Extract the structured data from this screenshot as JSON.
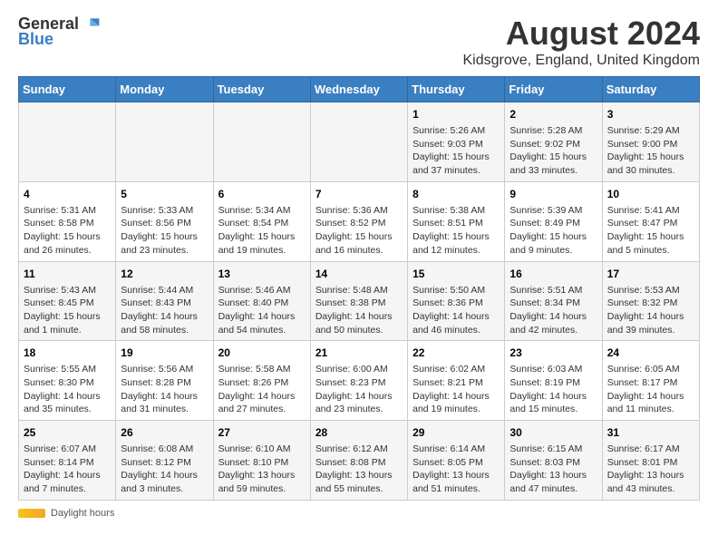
{
  "logo": {
    "general": "General",
    "blue": "Blue"
  },
  "title": "August 2024",
  "location": "Kidsgrove, England, United Kingdom",
  "days_of_week": [
    "Sunday",
    "Monday",
    "Tuesday",
    "Wednesday",
    "Thursday",
    "Friday",
    "Saturday"
  ],
  "weeks": [
    [
      {
        "day": "",
        "info": ""
      },
      {
        "day": "",
        "info": ""
      },
      {
        "day": "",
        "info": ""
      },
      {
        "day": "",
        "info": ""
      },
      {
        "day": "1",
        "info": "Sunrise: 5:26 AM\nSunset: 9:03 PM\nDaylight: 15 hours and 37 minutes."
      },
      {
        "day": "2",
        "info": "Sunrise: 5:28 AM\nSunset: 9:02 PM\nDaylight: 15 hours and 33 minutes."
      },
      {
        "day": "3",
        "info": "Sunrise: 5:29 AM\nSunset: 9:00 PM\nDaylight: 15 hours and 30 minutes."
      }
    ],
    [
      {
        "day": "4",
        "info": "Sunrise: 5:31 AM\nSunset: 8:58 PM\nDaylight: 15 hours and 26 minutes."
      },
      {
        "day": "5",
        "info": "Sunrise: 5:33 AM\nSunset: 8:56 PM\nDaylight: 15 hours and 23 minutes."
      },
      {
        "day": "6",
        "info": "Sunrise: 5:34 AM\nSunset: 8:54 PM\nDaylight: 15 hours and 19 minutes."
      },
      {
        "day": "7",
        "info": "Sunrise: 5:36 AM\nSunset: 8:52 PM\nDaylight: 15 hours and 16 minutes."
      },
      {
        "day": "8",
        "info": "Sunrise: 5:38 AM\nSunset: 8:51 PM\nDaylight: 15 hours and 12 minutes."
      },
      {
        "day": "9",
        "info": "Sunrise: 5:39 AM\nSunset: 8:49 PM\nDaylight: 15 hours and 9 minutes."
      },
      {
        "day": "10",
        "info": "Sunrise: 5:41 AM\nSunset: 8:47 PM\nDaylight: 15 hours and 5 minutes."
      }
    ],
    [
      {
        "day": "11",
        "info": "Sunrise: 5:43 AM\nSunset: 8:45 PM\nDaylight: 15 hours and 1 minute."
      },
      {
        "day": "12",
        "info": "Sunrise: 5:44 AM\nSunset: 8:43 PM\nDaylight: 14 hours and 58 minutes."
      },
      {
        "day": "13",
        "info": "Sunrise: 5:46 AM\nSunset: 8:40 PM\nDaylight: 14 hours and 54 minutes."
      },
      {
        "day": "14",
        "info": "Sunrise: 5:48 AM\nSunset: 8:38 PM\nDaylight: 14 hours and 50 minutes."
      },
      {
        "day": "15",
        "info": "Sunrise: 5:50 AM\nSunset: 8:36 PM\nDaylight: 14 hours and 46 minutes."
      },
      {
        "day": "16",
        "info": "Sunrise: 5:51 AM\nSunset: 8:34 PM\nDaylight: 14 hours and 42 minutes."
      },
      {
        "day": "17",
        "info": "Sunrise: 5:53 AM\nSunset: 8:32 PM\nDaylight: 14 hours and 39 minutes."
      }
    ],
    [
      {
        "day": "18",
        "info": "Sunrise: 5:55 AM\nSunset: 8:30 PM\nDaylight: 14 hours and 35 minutes."
      },
      {
        "day": "19",
        "info": "Sunrise: 5:56 AM\nSunset: 8:28 PM\nDaylight: 14 hours and 31 minutes."
      },
      {
        "day": "20",
        "info": "Sunrise: 5:58 AM\nSunset: 8:26 PM\nDaylight: 14 hours and 27 minutes."
      },
      {
        "day": "21",
        "info": "Sunrise: 6:00 AM\nSunset: 8:23 PM\nDaylight: 14 hours and 23 minutes."
      },
      {
        "day": "22",
        "info": "Sunrise: 6:02 AM\nSunset: 8:21 PM\nDaylight: 14 hours and 19 minutes."
      },
      {
        "day": "23",
        "info": "Sunrise: 6:03 AM\nSunset: 8:19 PM\nDaylight: 14 hours and 15 minutes."
      },
      {
        "day": "24",
        "info": "Sunrise: 6:05 AM\nSunset: 8:17 PM\nDaylight: 14 hours and 11 minutes."
      }
    ],
    [
      {
        "day": "25",
        "info": "Sunrise: 6:07 AM\nSunset: 8:14 PM\nDaylight: 14 hours and 7 minutes."
      },
      {
        "day": "26",
        "info": "Sunrise: 6:08 AM\nSunset: 8:12 PM\nDaylight: 14 hours and 3 minutes."
      },
      {
        "day": "27",
        "info": "Sunrise: 6:10 AM\nSunset: 8:10 PM\nDaylight: 13 hours and 59 minutes."
      },
      {
        "day": "28",
        "info": "Sunrise: 6:12 AM\nSunset: 8:08 PM\nDaylight: 13 hours and 55 minutes."
      },
      {
        "day": "29",
        "info": "Sunrise: 6:14 AM\nSunset: 8:05 PM\nDaylight: 13 hours and 51 minutes."
      },
      {
        "day": "30",
        "info": "Sunrise: 6:15 AM\nSunset: 8:03 PM\nDaylight: 13 hours and 47 minutes."
      },
      {
        "day": "31",
        "info": "Sunrise: 6:17 AM\nSunset: 8:01 PM\nDaylight: 13 hours and 43 minutes."
      }
    ]
  ],
  "footer": {
    "daylight_label": "Daylight hours"
  }
}
